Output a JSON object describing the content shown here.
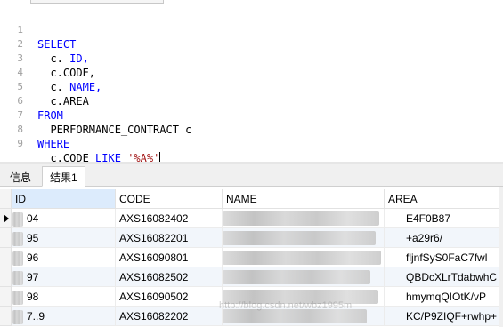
{
  "editor": {
    "line_numbers": [
      "1",
      "2",
      "3",
      "4",
      "5",
      "6",
      "7",
      "8",
      "9"
    ],
    "tokens": {
      "select": "SELECT",
      "c_id_prefix": "c.",
      "c_id_field": "ID,",
      "c_code": "c.CODE,",
      "c_name_prefix": "c.",
      "c_name_field": "NAME,",
      "c_area": "c.AREA",
      "from": "FROM",
      "table": "PERFORMANCE_CONTRACT c",
      "where": "WHERE",
      "cond_field": "c.CODE",
      "like": "LIKE",
      "pattern": "'%A%'"
    }
  },
  "result_tabs": [
    "信息",
    "结果1"
  ],
  "active_tab": "结果1",
  "table": {
    "columns": [
      "ID",
      "CODE",
      "NAME",
      "AREA"
    ],
    "selected_column": "ID",
    "rows": [
      {
        "id": "04",
        "code": "AXS16082402",
        "area": "E4F0B87"
      },
      {
        "id": "95",
        "code": "AXS16082201",
        "area": "+a29r6/"
      },
      {
        "id": "96",
        "code": "AXS16090801",
        "area": "fljnfSyS0FaC7fwl"
      },
      {
        "id": "97",
        "code": "AXS16082502",
        "area": "QBDcXLrTdabwhC"
      },
      {
        "id": "98",
        "code": "AXS16090502",
        "area": "hmymqQIOtK/vP"
      },
      {
        "id": "7..9",
        "code": "AXS16082202",
        "area": "KC/P9ZIQF+rwhp+"
      }
    ]
  },
  "watermark": "http://blog.csdn.net/wbz1995m"
}
